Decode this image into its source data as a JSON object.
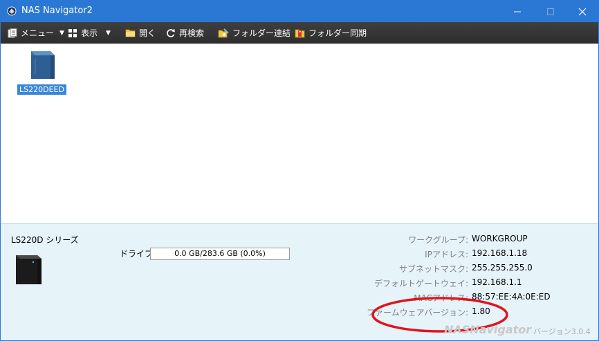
{
  "window": {
    "title": "NAS Navigator2",
    "icons": {
      "app": "nas-navigator-icon",
      "minimize": "minimize-icon",
      "maximize": "maximize-icon",
      "close": "close-icon"
    }
  },
  "toolbar": {
    "items": [
      {
        "label": "メニュー",
        "icon": "menu-icon",
        "has_dropdown": true
      },
      {
        "label": "表示",
        "icon": "view-icon",
        "has_dropdown": true
      },
      {
        "label": "開く",
        "icon": "folder-open-icon"
      },
      {
        "label": "再検索",
        "icon": "refresh-icon"
      },
      {
        "label": "フォルダー連結",
        "icon": "folder-link-icon"
      },
      {
        "label": "フォルダー同期",
        "icon": "folder-sync-icon"
      }
    ],
    "dropdown_arrow": "▼"
  },
  "devices": [
    {
      "name": "LS220DEED",
      "icon": "nas-device-icon",
      "selected": true
    }
  ],
  "details": {
    "series": "LS220D シリーズ",
    "drive_label": "ドライブ",
    "drive_usage": "0.0 GB/283.6 GB (0.0%)",
    "properties": [
      {
        "label": "ワークグループ:",
        "value": "WORKGROUP"
      },
      {
        "label": "IPアドレス:",
        "value": "192.168.1.18"
      },
      {
        "label": "サブネットマスク:",
        "value": "255.255.255.0"
      },
      {
        "label": "デフォルトゲートウェイ:",
        "value": "192.168.1.1"
      },
      {
        "label": "MACアドレス:",
        "value": "88:57:EE:4A:0E:ED"
      },
      {
        "label": "ファームウェアバージョン:",
        "value": "1.80"
      }
    ],
    "brand": "NASNavigator",
    "version": "バージョン3.0.4",
    "highlight_color": "#e0141e"
  },
  "colors": {
    "titlebar": "#2b78d4",
    "toolbar": "#333333",
    "panel": "#e6f3f9",
    "selection": "#3a87d6"
  }
}
